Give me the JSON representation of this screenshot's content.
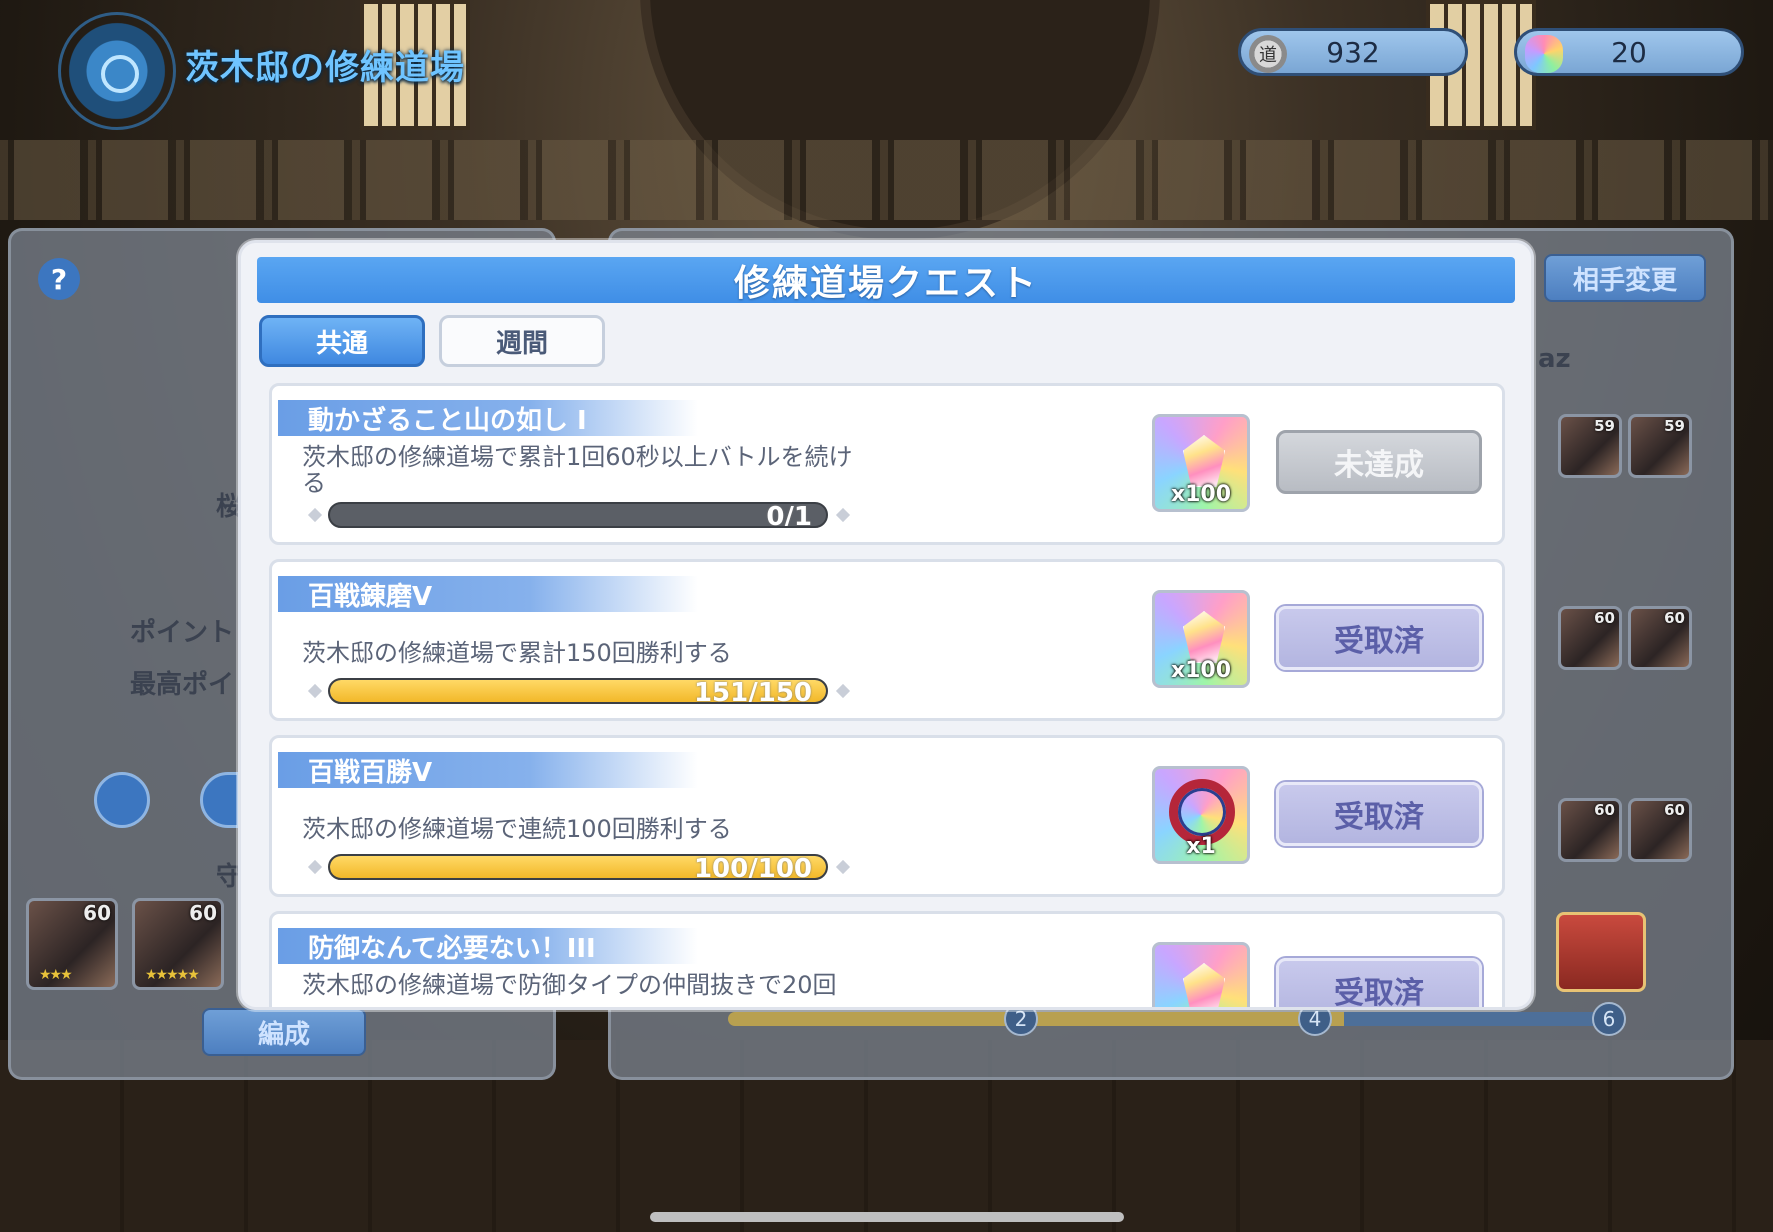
{
  "header": {
    "title": "茨木邸の修練道場",
    "currencies": [
      {
        "icon": "coin-icon",
        "icon_text": "道",
        "value": "932"
      },
      {
        "icon": "gem-icon",
        "icon_text": "",
        "value": "20"
      }
    ]
  },
  "background": {
    "help_label": "?",
    "change_opponent_label": "相手変更",
    "partial_name_left": "桜",
    "partial_name_right": "az",
    "points_label": "ポイント",
    "best_points_label": "最高ポイ",
    "defense_label": "守",
    "formation_label": "編成",
    "left_team": [
      {
        "level": "60",
        "stars": "★★★"
      },
      {
        "level": "60",
        "stars": "★★★★★"
      }
    ],
    "right_team_row1": [
      {
        "level": "59"
      },
      {
        "level": "59"
      },
      {
        "level": "59"
      }
    ],
    "right_team_row2": [
      {
        "level": "60"
      },
      {
        "level": "60"
      },
      {
        "level": "60"
      }
    ],
    "right_team_row3": [
      {
        "level": "60"
      },
      {
        "level": "60"
      },
      {
        "level": "60"
      }
    ],
    "progress_nodes": [
      "2",
      "4",
      "6"
    ],
    "progress_fraction": 0.7
  },
  "modal": {
    "title": "修練道場クエスト",
    "tabs": [
      {
        "label": "共通",
        "active": true
      },
      {
        "label": "週間",
        "active": false
      }
    ],
    "quests": [
      {
        "title": "動かざること山の如し I",
        "description": "茨木邸の修練道場で累計1回60秒以上バトルを続ける",
        "progress_text": "0/1",
        "progress_fraction": 0,
        "reward_type": "crystal",
        "reward_count": "x100",
        "button_label": "未達成",
        "button_state": "disabled"
      },
      {
        "title": "百戦錬磨V",
        "description": "茨木邸の修練道場で累計150回勝利する",
        "progress_text": "151/150",
        "progress_fraction": 1,
        "reward_type": "crystal",
        "reward_count": "x100",
        "button_label": "受取済",
        "button_state": "claimed"
      },
      {
        "title": "百戦百勝V",
        "description": "茨木邸の修練道場で連続100回勝利する",
        "progress_text": "100/100",
        "progress_fraction": 1,
        "reward_type": "wreath",
        "reward_count": "x1",
        "button_label": "受取済",
        "button_state": "claimed"
      },
      {
        "title": "防御なんて必要ない！III",
        "description": "茨木邸の修練道場で防御タイプの仲間抜きで20回",
        "progress_text": "",
        "progress_fraction": 1,
        "reward_type": "crystal",
        "reward_count": "",
        "button_label": "受取済",
        "button_state": "claimed"
      }
    ]
  }
}
